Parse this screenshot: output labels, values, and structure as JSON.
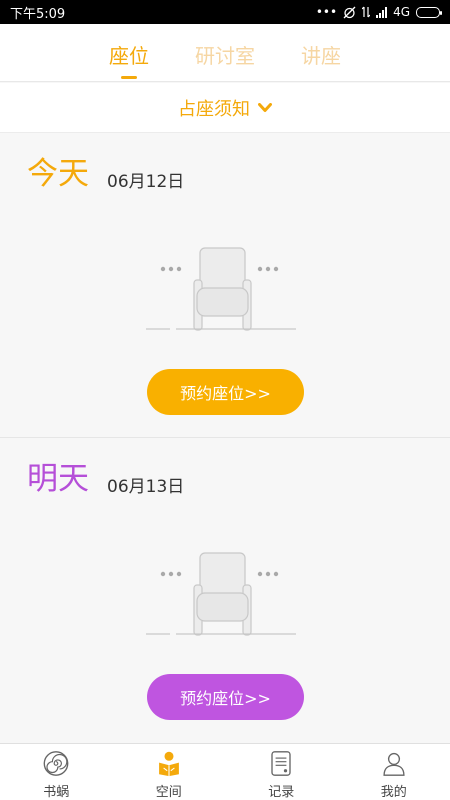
{
  "status_bar": {
    "time": "下午5:09",
    "dots": "•••",
    "network": "4G"
  },
  "tabs": [
    {
      "label": "座位",
      "active": true
    },
    {
      "label": "研讨室",
      "active": false
    },
    {
      "label": "讲座",
      "active": false
    }
  ],
  "notice": {
    "label": "占座须知"
  },
  "days": [
    {
      "label": "今天",
      "date": "06月12日",
      "color": "#f4a90b",
      "button_label": "预约座位>>",
      "button_color": "#f9b000"
    },
    {
      "label": "明天",
      "date": "06月13日",
      "color": "#b54fd8",
      "button_label": "预约座位>>",
      "button_color": "#bf55e0"
    }
  ],
  "bottom_nav": [
    {
      "label": "书蜗",
      "icon": "snail-shell-icon",
      "active": false
    },
    {
      "label": "空间",
      "icon": "reader-icon",
      "active": true
    },
    {
      "label": "记录",
      "icon": "record-icon",
      "active": false
    },
    {
      "label": "我的",
      "icon": "profile-icon",
      "active": false
    }
  ],
  "colors": {
    "accent": "#f4a90b",
    "purple": "#b54fd8"
  }
}
